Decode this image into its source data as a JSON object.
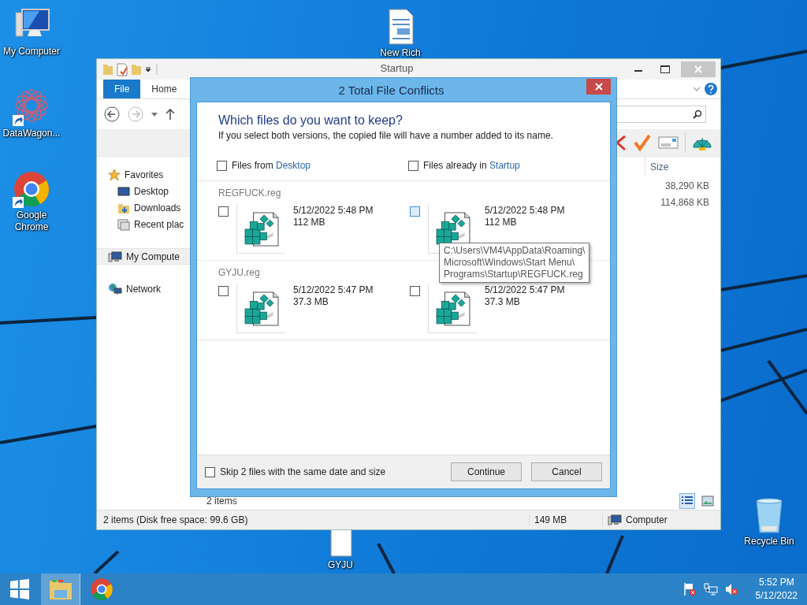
{
  "desktop": {
    "icons": [
      {
        "label": "My Computer",
        "kind": "computer",
        "shortcut": false
      },
      {
        "label": "DataWagon...",
        "kind": "flower",
        "shortcut": true
      },
      {
        "label": "Google Chrome",
        "kind": "chrome",
        "shortcut": true
      },
      {
        "label": "New Rich",
        "kind": "document",
        "shortcut": false
      },
      {
        "label": "GYJU",
        "kind": "file",
        "shortcut": false
      },
      {
        "label": "Recycle Bin",
        "kind": "recycle",
        "shortcut": false
      }
    ]
  },
  "explorer": {
    "title": "Startup",
    "tabs": [
      {
        "label": "File",
        "selected": true
      },
      {
        "label": "Home",
        "selected": false
      }
    ],
    "nav": [
      {
        "label": "Favorites",
        "kind": "star",
        "selected": false,
        "children": [
          {
            "label": "Desktop",
            "kind": "desktop",
            "selected": false
          },
          {
            "label": "Downloads",
            "kind": "downloads",
            "selected": false
          },
          {
            "label": "Recent plac",
            "kind": "recent",
            "selected": false
          }
        ]
      },
      {
        "label": "My Compute",
        "kind": "computer",
        "selected": true
      },
      {
        "label": "Network",
        "kind": "network",
        "selected": false
      }
    ],
    "columns": [
      "Size"
    ],
    "rows": [
      {
        "size": "38,290 KB"
      },
      {
        "size": "114,868 KB"
      }
    ],
    "item_count": "2 items",
    "status_bar": {
      "summary": "2 items (Disk free space: 99.6 GB)",
      "size": "149 MB",
      "location": "Computer"
    }
  },
  "dialog": {
    "title": "2 Total File Conflicts",
    "heading": "Which files do you want to keep?",
    "subtext": "If you select both versions, the copied file will have a number added to its name.",
    "sources": [
      {
        "prefix": "Files from ",
        "folder": "Desktop",
        "checked": false
      },
      {
        "prefix": "Files already in ",
        "folder": "Startup",
        "checked": false
      }
    ],
    "groups": [
      {
        "name": "REGFUCK.reg",
        "versions": [
          {
            "date": "5/12/2022 5:48 PM",
            "size": "112 MB",
            "checked": false,
            "hot": false
          },
          {
            "date": "5/12/2022 5:48 PM",
            "size": "112 MB",
            "checked": false,
            "hot": true
          }
        ]
      },
      {
        "name": "GYJU.reg",
        "versions": [
          {
            "date": "5/12/2022 5:47 PM",
            "size": "37.3 MB",
            "checked": false,
            "hot": false
          },
          {
            "date": "5/12/2022 5:47 PM",
            "size": "37.3 MB",
            "checked": false,
            "hot": false
          }
        ]
      }
    ],
    "tooltip": [
      "C:\\Users\\VM4\\AppData\\Roaming\\",
      "Microsoft\\Windows\\Start Menu\\",
      "Programs\\Startup\\REGFUCK.reg"
    ],
    "skip": {
      "label": "Skip 2 files with the same date and size",
      "checked": false
    },
    "buttons": [
      "Continue",
      "Cancel"
    ]
  },
  "taskbar": {
    "apps": [
      {
        "kind": "explorer",
        "selected": true
      },
      {
        "kind": "chrome",
        "selected": false
      }
    ],
    "time": "5:52 PM",
    "date": "5/12/2022"
  }
}
